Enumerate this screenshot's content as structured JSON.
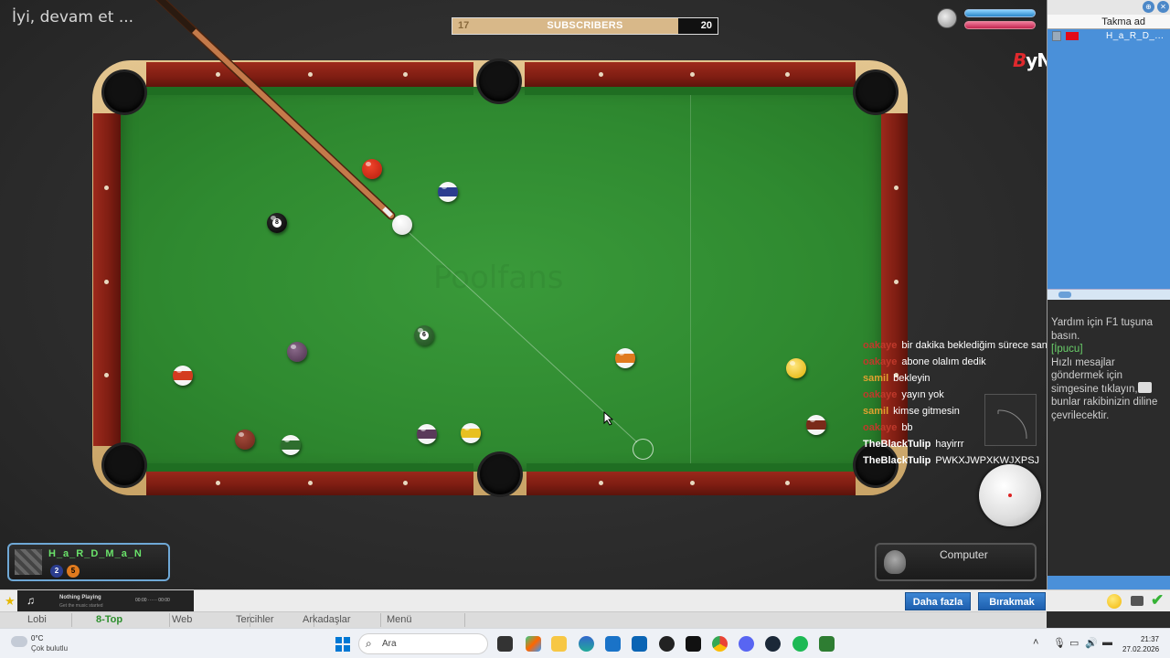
{
  "game": {
    "status_message": "İyi, devam et ...",
    "subscribers": {
      "current": "17",
      "label": "SUBSCRIBERS",
      "goal": "20",
      "progress": 0.85
    },
    "watermark": "Poolfans",
    "brand": {
      "mark": "B",
      "name": "yNoGame"
    }
  },
  "chat": [
    {
      "nick": "oakaye",
      "nick_color": "#c0392b",
      "text": "bir dakika beklediğim sürece sana dayanıyım ogi"
    },
    {
      "nick": "oakaye",
      "nick_color": "#c0392b",
      "text": "abone olalım dedik"
    },
    {
      "nick": "samil",
      "nick_color": "#e0a030",
      "text": "bekleyin"
    },
    {
      "nick": "oakaye",
      "nick_color": "#c0392b",
      "text": "yayın yok"
    },
    {
      "nick": "samil",
      "nick_color": "#e0a030",
      "text": "kimse gitmesin"
    },
    {
      "nick": "oakaye",
      "nick_color": "#c0392b",
      "text": "bb"
    },
    {
      "nick": "TheBlackTulip",
      "nick_color": "#ffffff",
      "text": "hayirrr"
    },
    {
      "nick": "TheBlackTulip",
      "nick_color": "#ffffff",
      "text": "PWKXJWPXKWJXPSJ"
    }
  ],
  "players": {
    "me": {
      "name": "H_a_R_D_M_a_N",
      "balls": [
        "2",
        "5"
      ]
    },
    "opponent": {
      "name": "Computer"
    }
  },
  "music": {
    "title": "Nothing Playing",
    "subtitle": "Get the music started",
    "time_start": "00:00",
    "time_end": "00:00"
  },
  "toolbar": {
    "more_label": "Daha fazla",
    "quit_label": "Bırakmak"
  },
  "menu": [
    "Lobi",
    "8-Top",
    "Web",
    "Tercihler",
    "Arkadaşlar",
    "Menü"
  ],
  "menu_active": "8-Top",
  "right_panel": {
    "header": "Takma ad",
    "user": "H_a_R_D_...",
    "help_line": "Yardım için F1 tuşuna basın.",
    "tip_label": "[İpucu]",
    "tip_text": "Hızlı mesajlar göndermek için simgesine tıklayın, bunlar rakibinizin diline çevrilecektir."
  },
  "taskbar": {
    "temperature": "0°C",
    "condition": "Çok bulutlu",
    "search_placeholder": "Ara",
    "time": "21:37",
    "date": "27.02.2026"
  },
  "colors": {
    "cloth": "#2f8a30",
    "rail": "#7d1d12",
    "accent_blue": "#4a90d9"
  }
}
